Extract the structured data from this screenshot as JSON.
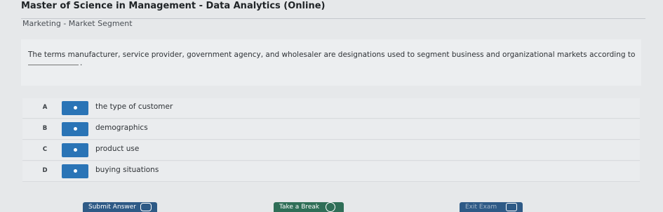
{
  "header": {
    "program_title": "Master of Science in Management - Data Analytics (Online)",
    "breadcrumb": "Marketing - Market Segment"
  },
  "question": {
    "text": "The terms manufacturer, service provider, government agency, and wholesaler are designations used to segment business and organizational markets according to",
    "blank_suffix": "."
  },
  "options": [
    {
      "letter": "A",
      "label": "the type of customer"
    },
    {
      "letter": "B",
      "label": "demographics"
    },
    {
      "letter": "C",
      "label": "product use"
    },
    {
      "letter": "D",
      "label": "buying situations"
    }
  ],
  "footer": {
    "submit_label": "Submit Answer",
    "break_label": "Take a Break",
    "exit_label": "Exit Exam"
  },
  "colors": {
    "radio_blue": "#2a74b6",
    "submit_blue": "#2e5a86",
    "break_green": "#2f6e57"
  }
}
